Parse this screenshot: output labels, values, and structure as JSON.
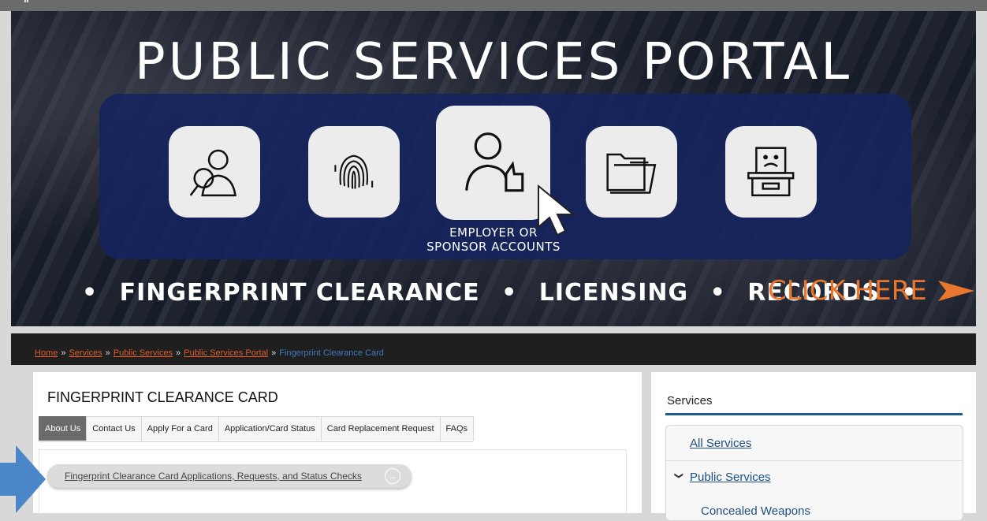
{
  "hero": {
    "title": "PUBLIC SERVICES PORTAL",
    "featured_tile_label_line1": "EMPLOYER OR",
    "featured_tile_label_line2": "SPONSOR ACCOUNTS",
    "taglines": [
      "•",
      "FINGERPRINT CLEARANCE",
      "•",
      "LICENSING",
      "•",
      "RECORDS",
      "•"
    ],
    "cta": "CLICK HERE",
    "icons": [
      "person-search-icon",
      "fingerprint-icon",
      "employer-thumbs-up-icon",
      "folders-icon",
      "sad-document-icon"
    ]
  },
  "breadcrumb": {
    "items": [
      "Home",
      "Services",
      "Public Services",
      "Public Services Portal"
    ],
    "separator": "»",
    "current": "Fingerprint Clearance Card"
  },
  "main": {
    "title": "FINGERPRINT CLEARANCE CARD",
    "tabs": [
      "About Us",
      "Contact Us",
      "Apply For a Card",
      "Application/Card Status",
      "Card Replacement Request",
      "FAQs"
    ],
    "active_tab": "About Us",
    "link_pill": "Fingerprint Clearance Card Applications, Requests, and Status Checks"
  },
  "sidebar": {
    "title": "Services",
    "items": [
      "All Services",
      "Public Services",
      "Concealed Weapons"
    ]
  },
  "colors": {
    "accent_orange": "#e8762d",
    "link_red": "#e05a2a",
    "sidebar_rule": "#1e5b91",
    "panel_blue": "#14235f",
    "annotation_arrow": "#4a86c8"
  }
}
